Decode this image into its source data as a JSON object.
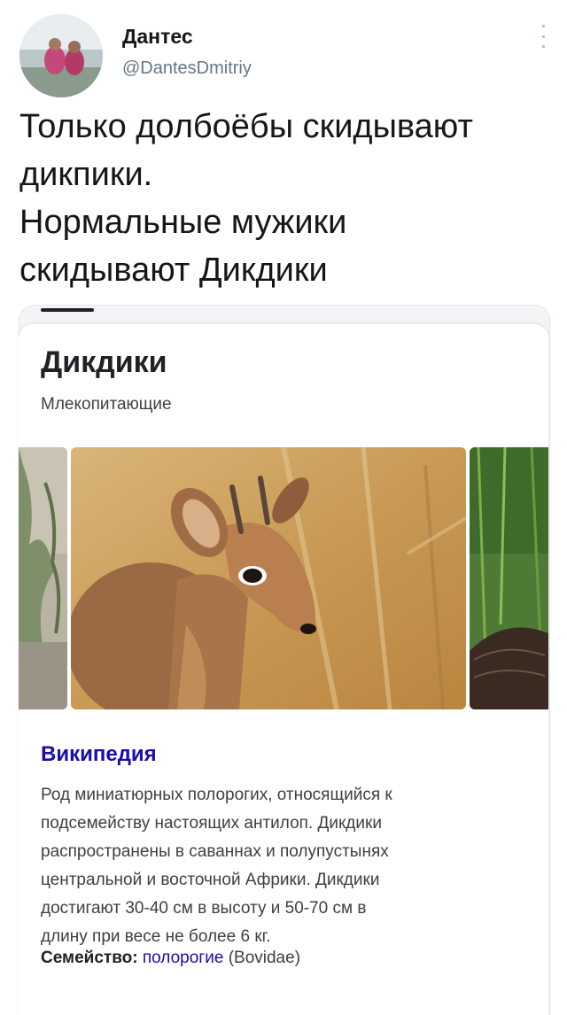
{
  "tweet": {
    "author_name": "Дантес",
    "author_handle": "@DantesDmitriy",
    "text_lines": [
      "Только долбоёбы скидывают",
      "дикпики.",
      "Нормальные мужики",
      "скидывают Дикдики"
    ]
  },
  "card": {
    "title": "Дикдики",
    "subtitle": "Млекопитающие",
    "source": "Википедия",
    "description_lines": [
      "Род миниатюрных полорогих, относящийся к",
      "подсемейству настоящих антилоп. Дикдики",
      "распространены в саваннах и полупустынях",
      "центральной и восточной Африки. Дикдики",
      "достигают 30-40 см в высоту и 50-70 см в",
      "длину при весе не более 6 кг."
    ],
    "family": {
      "label": "Семейство:",
      "link": "полорогие",
      "latin": "(Bovidae)"
    }
  },
  "icons": {
    "more": "more-vertical-icon"
  },
  "colors": {
    "link": "#1a0dab",
    "text": "#14171a",
    "secondary": "#657786"
  }
}
